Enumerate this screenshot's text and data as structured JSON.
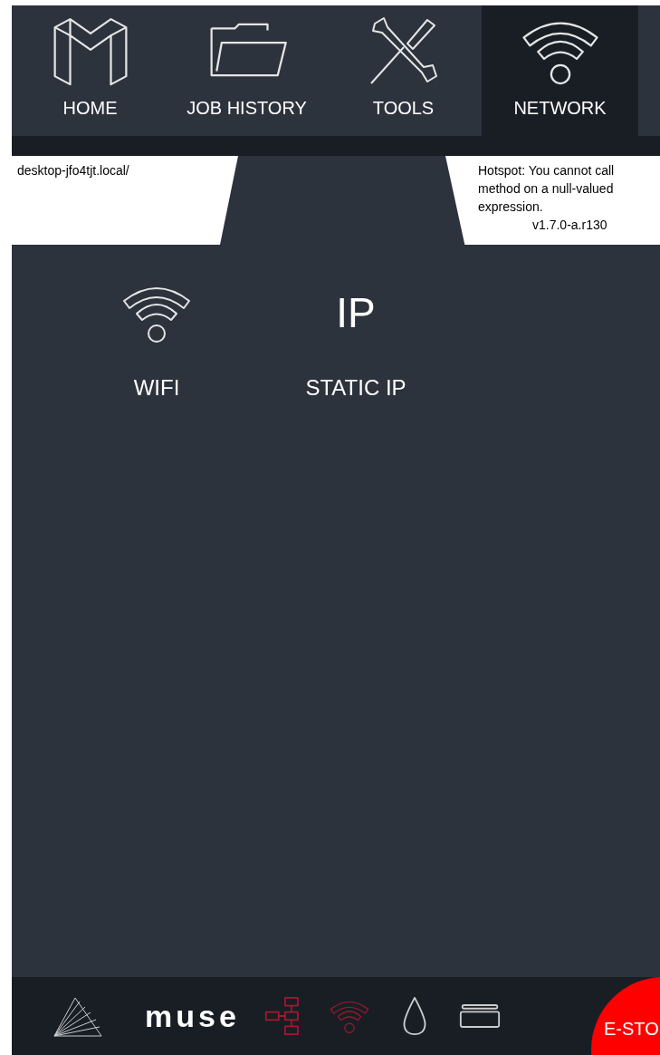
{
  "nav_tabs": [
    {
      "label": "HOME",
      "kind": "logo",
      "selected": false
    },
    {
      "label": "JOB HISTORY",
      "kind": "folder",
      "selected": false
    },
    {
      "label": "TOOLS",
      "kind": "tools",
      "selected": false
    },
    {
      "label": "NETWORK",
      "kind": "wifi",
      "selected": true
    }
  ],
  "info_bar": {
    "host": "desktop-jfo4tjt.local/",
    "message_lines": [
      "Hotspot: You cannot call",
      "method on a null-valued",
      "expression."
    ],
    "version": "v1.7.0-a.r130"
  },
  "options": [
    {
      "label": "WIFI",
      "kind": "icon"
    },
    {
      "label": "STATIC IP",
      "kind": "text",
      "glyph": "IP"
    }
  ],
  "footer": {
    "logo": "muse",
    "status_icons": [
      {
        "kind": "network",
        "active": true
      },
      {
        "kind": "wifi",
        "active": true
      },
      {
        "kind": "drop",
        "active": false
      },
      {
        "kind": "card",
        "active": false
      }
    ],
    "estop": "E-STO"
  }
}
